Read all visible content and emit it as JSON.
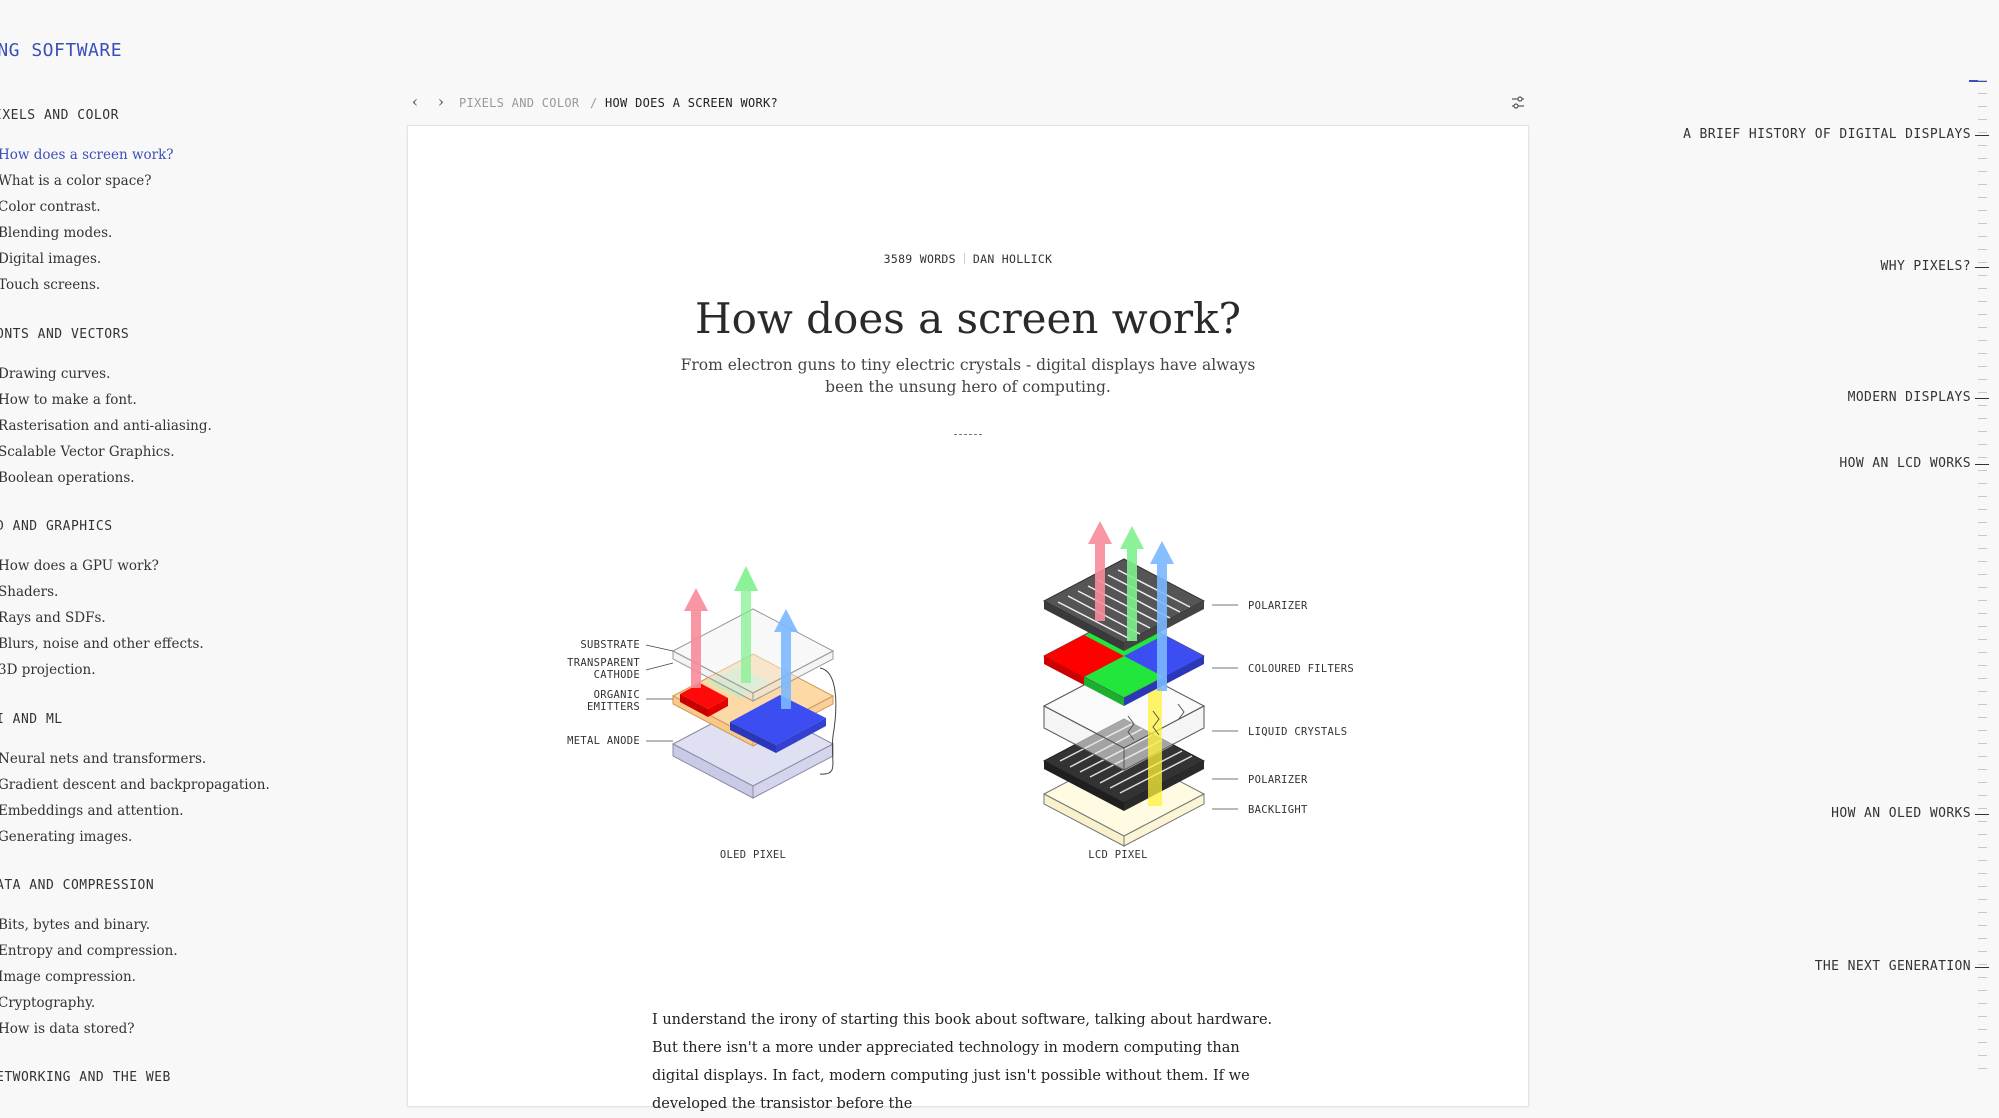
{
  "sidebar": {
    "brand": "ING SOFTWARE",
    "sections": [
      {
        "title": "IXELS AND COLOR",
        "items": [
          "How does a screen work?",
          "What is a color space?",
          "Color contrast.",
          "Blending modes.",
          "Digital images.",
          "Touch screens."
        ]
      },
      {
        "title": "ONTS AND VECTORS",
        "items": [
          "Drawing curves.",
          "How to make a font.",
          "Rasterisation and anti-aliasing.",
          "Scalable Vector Graphics.",
          "Boolean operations."
        ]
      },
      {
        "title": "D AND GRAPHICS",
        "items": [
          "How does a GPU work?",
          "Shaders.",
          "Rays and SDFs.",
          "Blurs, noise and other effects.",
          "3D projection."
        ]
      },
      {
        "title": "I AND ML",
        "items": [
          "Neural nets and transformers.",
          "Gradient descent and backpropagation.",
          "Embeddings and attention.",
          "Generating images."
        ]
      },
      {
        "title": "ATA AND COMPRESSION",
        "items": [
          "Bits, bytes and binary.",
          "Entropy and compression.",
          "Image compression.",
          "Cryptography.",
          "How is data stored?"
        ]
      },
      {
        "title": "ETWORKING AND THE WEB",
        "items": []
      }
    ],
    "active_item": "How does a screen work?"
  },
  "topbar": {
    "back_icon": "‹",
    "forward_icon": "›",
    "crumb_parent": "PIXELS AND COLOR",
    "crumb_separator": "/",
    "crumb_current": "HOW DOES A SCREEN WORK?",
    "settings_icon": "sliders-icon"
  },
  "article": {
    "word_count": "3589 WORDS",
    "author": "DAN HOLLICK",
    "title": "How does a screen work?",
    "subtitle": "From electron guns to tiny electric crystals - digital displays have always been the unsung hero of computing.",
    "body": "I understand the irony of starting this book about software, talking about hardware. But there isn't a more under appreciated technology in modern computing than digital displays. In fact, modern computing just isn't possible without them. If we developed the transistor before the"
  },
  "illustration": {
    "oled_caption": "OLED PIXEL",
    "lcd_caption": "LCD PIXEL",
    "oled_labels": [
      "SUBSTRATE",
      "TRANSPARENT",
      "CATHODE",
      "ORGANIC",
      "EMITTERS",
      "METAL ANODE"
    ],
    "lcd_labels": [
      "POLARIZER",
      "COLOURED FILTERS",
      "LIQUID CRYSTALS",
      "POLARIZER",
      "BACKLIGHT"
    ],
    "colors": {
      "red": "#ff0000",
      "green": "#22e63b",
      "blue": "#3c4df2",
      "orange": "#fcd9a6",
      "yellow": "#fff23a",
      "arrow_red": "#f88b9b",
      "arrow_green": "#7ff18f",
      "arrow_blue": "#7ab8ff"
    }
  },
  "toc": {
    "items": [
      "A BRIEF HISTORY OF DIGITAL DISPLAYS",
      "WHY PIXELS?",
      "MODERN DISPLAYS",
      "HOW AN LCD WORKS",
      "HOW AN OLED WORKS",
      "THE NEXT GENERATION"
    ]
  },
  "colors": {
    "accent": "#3b4fb8",
    "background": "#f8f8f8",
    "paper": "#ffffff"
  }
}
